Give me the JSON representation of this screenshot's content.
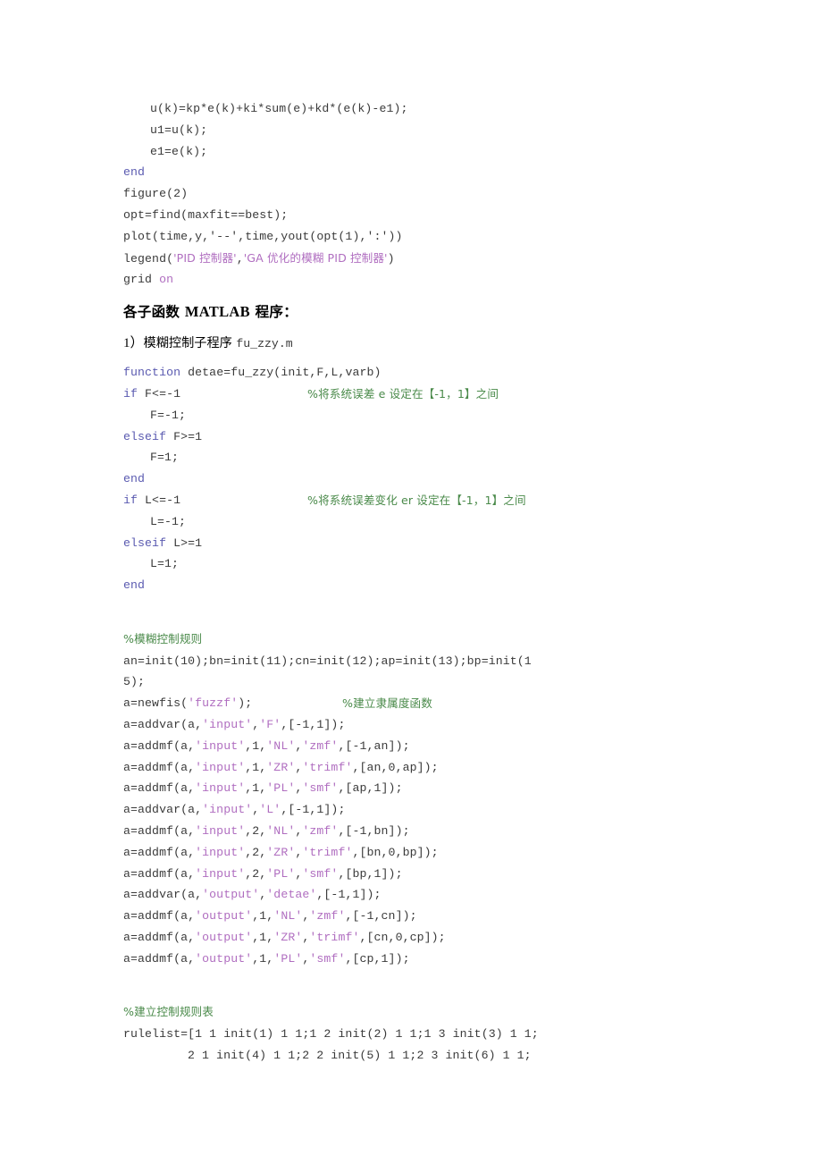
{
  "document": {
    "language": "zh-CN",
    "type": "matlab-source-listing",
    "colors": {
      "keyword": "#5a5ab0",
      "string": "#b06ec0",
      "comment": "#4a8a4a",
      "code": "#3a3a3a",
      "text": "#000000",
      "background": "#ffffff"
    }
  },
  "block1": {
    "line1": "u(k)=kp*e(k)+ki*sum(e)+kd*(e(k)-e1);",
    "line2": "u1=u(k);",
    "line3": "e1=e(k);",
    "line4_kw": "end",
    "line5": "figure(2)",
    "line6": "opt=find(maxfit==best);",
    "line7": "plot(time,y,'--',time,yout(opt(1),':'))",
    "line8_a": "legend(",
    "line8_s1": "'PID 控制器'",
    "line8_b": ",",
    "line8_s2": "'GA 优化的模糊 PID 控制器'",
    "line8_c": ")",
    "line9_a": "grid ",
    "line9_kw": "on"
  },
  "heading": {
    "cn_before": "各子函数 ",
    "latin": "MATLAB",
    "cn_after": " 程序："
  },
  "listitem1": {
    "num": "1）",
    "cn": "模糊控制子程序 ",
    "mono": "fu_zzy.m"
  },
  "block2": {
    "fn_kw": "function",
    "fn_rest": " detae=fu_zzy(init,F,L,varb)",
    "if1_kw": "if",
    "if1_rest": " F<=-1",
    "if1_cmt": "%将系统误差 e 设定在【-1，1】之间",
    "l1": "F=-1;",
    "elseif1_kw": "elseif",
    "elseif1_rest": " F>=1",
    "l2": "F=1;",
    "end1_kw": "end",
    "if2_kw": "if",
    "if2_rest": " L<=-1",
    "if2_cmt": "%将系统误差变化 er 设定在【-1，1】之间",
    "l3": "L=-1;",
    "elseif2_kw": "elseif",
    "elseif2_rest": " L>=1",
    "l4": "L=1;",
    "end2_kw": "end"
  },
  "block3": {
    "cmt1": "%模糊控制规则",
    "init_line1": "an=init(10);bn=init(11);cn=init(12);ap=init(13);bp=init(1",
    "init_line2": "5);",
    "newfis_a": "a=newfis(",
    "newfis_s": "'fuzzf'",
    "newfis_b": ");",
    "newfis_cmt": "%建立隶属度函数",
    "mf_lines": [
      {
        "pre": "a=addvar(a,",
        "s1": "'input'",
        "mid1": ",",
        "s2": "'F'",
        "post": ",[-1,1]);"
      },
      {
        "pre": "a=addmf(a,",
        "s1": "'input'",
        "mid1": ",1,",
        "s2": "'NL'",
        "mid2": ",",
        "s3": "'zmf'",
        "post": ",[-1,an]);"
      },
      {
        "pre": "a=addmf(a,",
        "s1": "'input'",
        "mid1": ",1,",
        "s2": "'ZR'",
        "mid2": ",",
        "s3": "'trimf'",
        "post": ",[an,0,ap]);"
      },
      {
        "pre": "a=addmf(a,",
        "s1": "'input'",
        "mid1": ",1,",
        "s2": "'PL'",
        "mid2": ",",
        "s3": "'smf'",
        "post": ",[ap,1]);"
      },
      {
        "pre": "a=addvar(a,",
        "s1": "'input'",
        "mid1": ",",
        "s2": "'L'",
        "post": ",[-1,1]);"
      },
      {
        "pre": "a=addmf(a,",
        "s1": "'input'",
        "mid1": ",2,",
        "s2": "'NL'",
        "mid2": ",",
        "s3": "'zmf'",
        "post": ",[-1,bn]);"
      },
      {
        "pre": "a=addmf(a,",
        "s1": "'input'",
        "mid1": ",2,",
        "s2": "'ZR'",
        "mid2": ",",
        "s3": "'trimf'",
        "post": ",[bn,0,bp]);"
      },
      {
        "pre": "a=addmf(a,",
        "s1": "'input'",
        "mid1": ",2,",
        "s2": "'PL'",
        "mid2": ",",
        "s3": "'smf'",
        "post": ",[bp,1]);"
      },
      {
        "pre": "a=addvar(a,",
        "s1": "'output'",
        "mid1": ",",
        "s2": "'detae'",
        "post": ",[-1,1]);"
      },
      {
        "pre": "a=addmf(a,",
        "s1": "'output'",
        "mid1": ",1,",
        "s2": "'NL'",
        "mid2": ",",
        "s3": "'zmf'",
        "post": ",[-1,cn]);"
      },
      {
        "pre": "a=addmf(a,",
        "s1": "'output'",
        "mid1": ",1,",
        "s2": "'ZR'",
        "mid2": ",",
        "s3": "'trimf'",
        "post": ",[cn,0,cp]);"
      },
      {
        "pre": "a=addmf(a,",
        "s1": "'output'",
        "mid1": ",1,",
        "s2": "'PL'",
        "mid2": ",",
        "s3": "'smf'",
        "post": ",[cp,1]);"
      }
    ]
  },
  "block4": {
    "cmt": "%建立控制规则表",
    "rule_line1": "rulelist=[1 1 init(1) 1 1;1 2 init(2) 1 1;1 3 init(3) 1 1;",
    "rule_line2": "2 1 init(4) 1 1;2 2 init(5) 1 1;2 3 init(6) 1 1;"
  }
}
